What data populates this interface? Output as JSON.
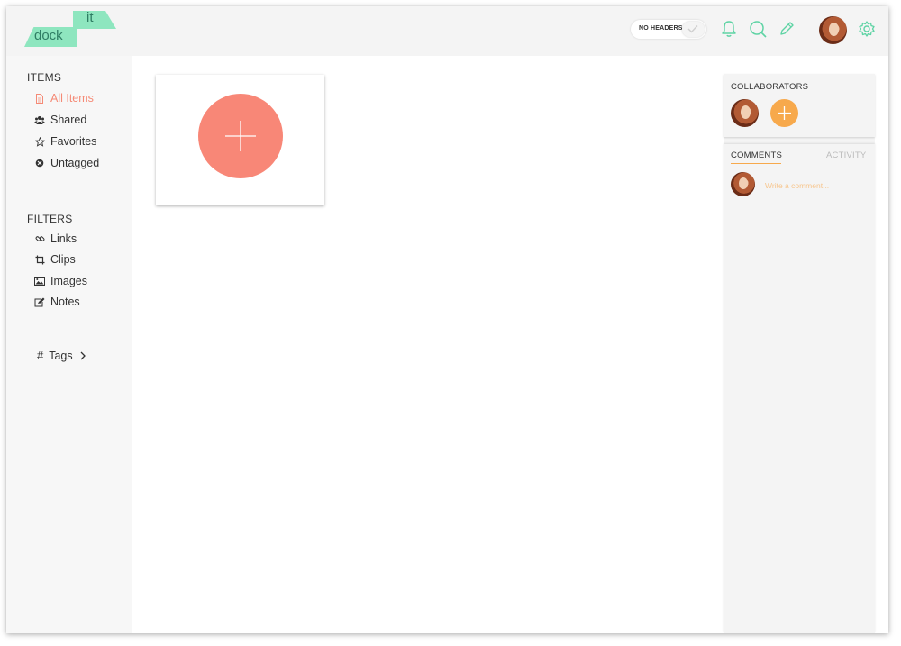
{
  "logo": {
    "top_word": "it",
    "bottom_word": "dock"
  },
  "header": {
    "toggle_label": "NO HEADERS",
    "icons": [
      "bell-icon",
      "search-icon",
      "pencil-icon",
      "user-avatar",
      "gear-icon"
    ]
  },
  "colors": {
    "accent_green": "#8ee6bf",
    "accent_coral": "#f88777",
    "accent_orange": "#f7a94c",
    "active_nav": "#f58a76"
  },
  "sidebar": {
    "items_title": "ITEMS",
    "items": [
      {
        "label": "All Items",
        "icon": "document-icon",
        "active": true
      },
      {
        "label": "Shared",
        "icon": "users-icon",
        "active": false
      },
      {
        "label": "Favorites",
        "icon": "star-icon",
        "active": false
      },
      {
        "label": "Untagged",
        "icon": "untagged-icon",
        "active": false
      }
    ],
    "filters_title": "FILTERS",
    "filters": [
      {
        "label": "Links",
        "icon": "link-icon"
      },
      {
        "label": "Clips",
        "icon": "crop-icon"
      },
      {
        "label": "Images",
        "icon": "image-icon"
      },
      {
        "label": "Notes",
        "icon": "edit-icon"
      }
    ],
    "tags_label": "Tags"
  },
  "right_panel": {
    "collaborators_title": "COLLABORATORS",
    "tabs": {
      "comments": "COMMENTS",
      "activity": "ACTIVITY"
    },
    "comment_placeholder": "Write a comment..."
  }
}
